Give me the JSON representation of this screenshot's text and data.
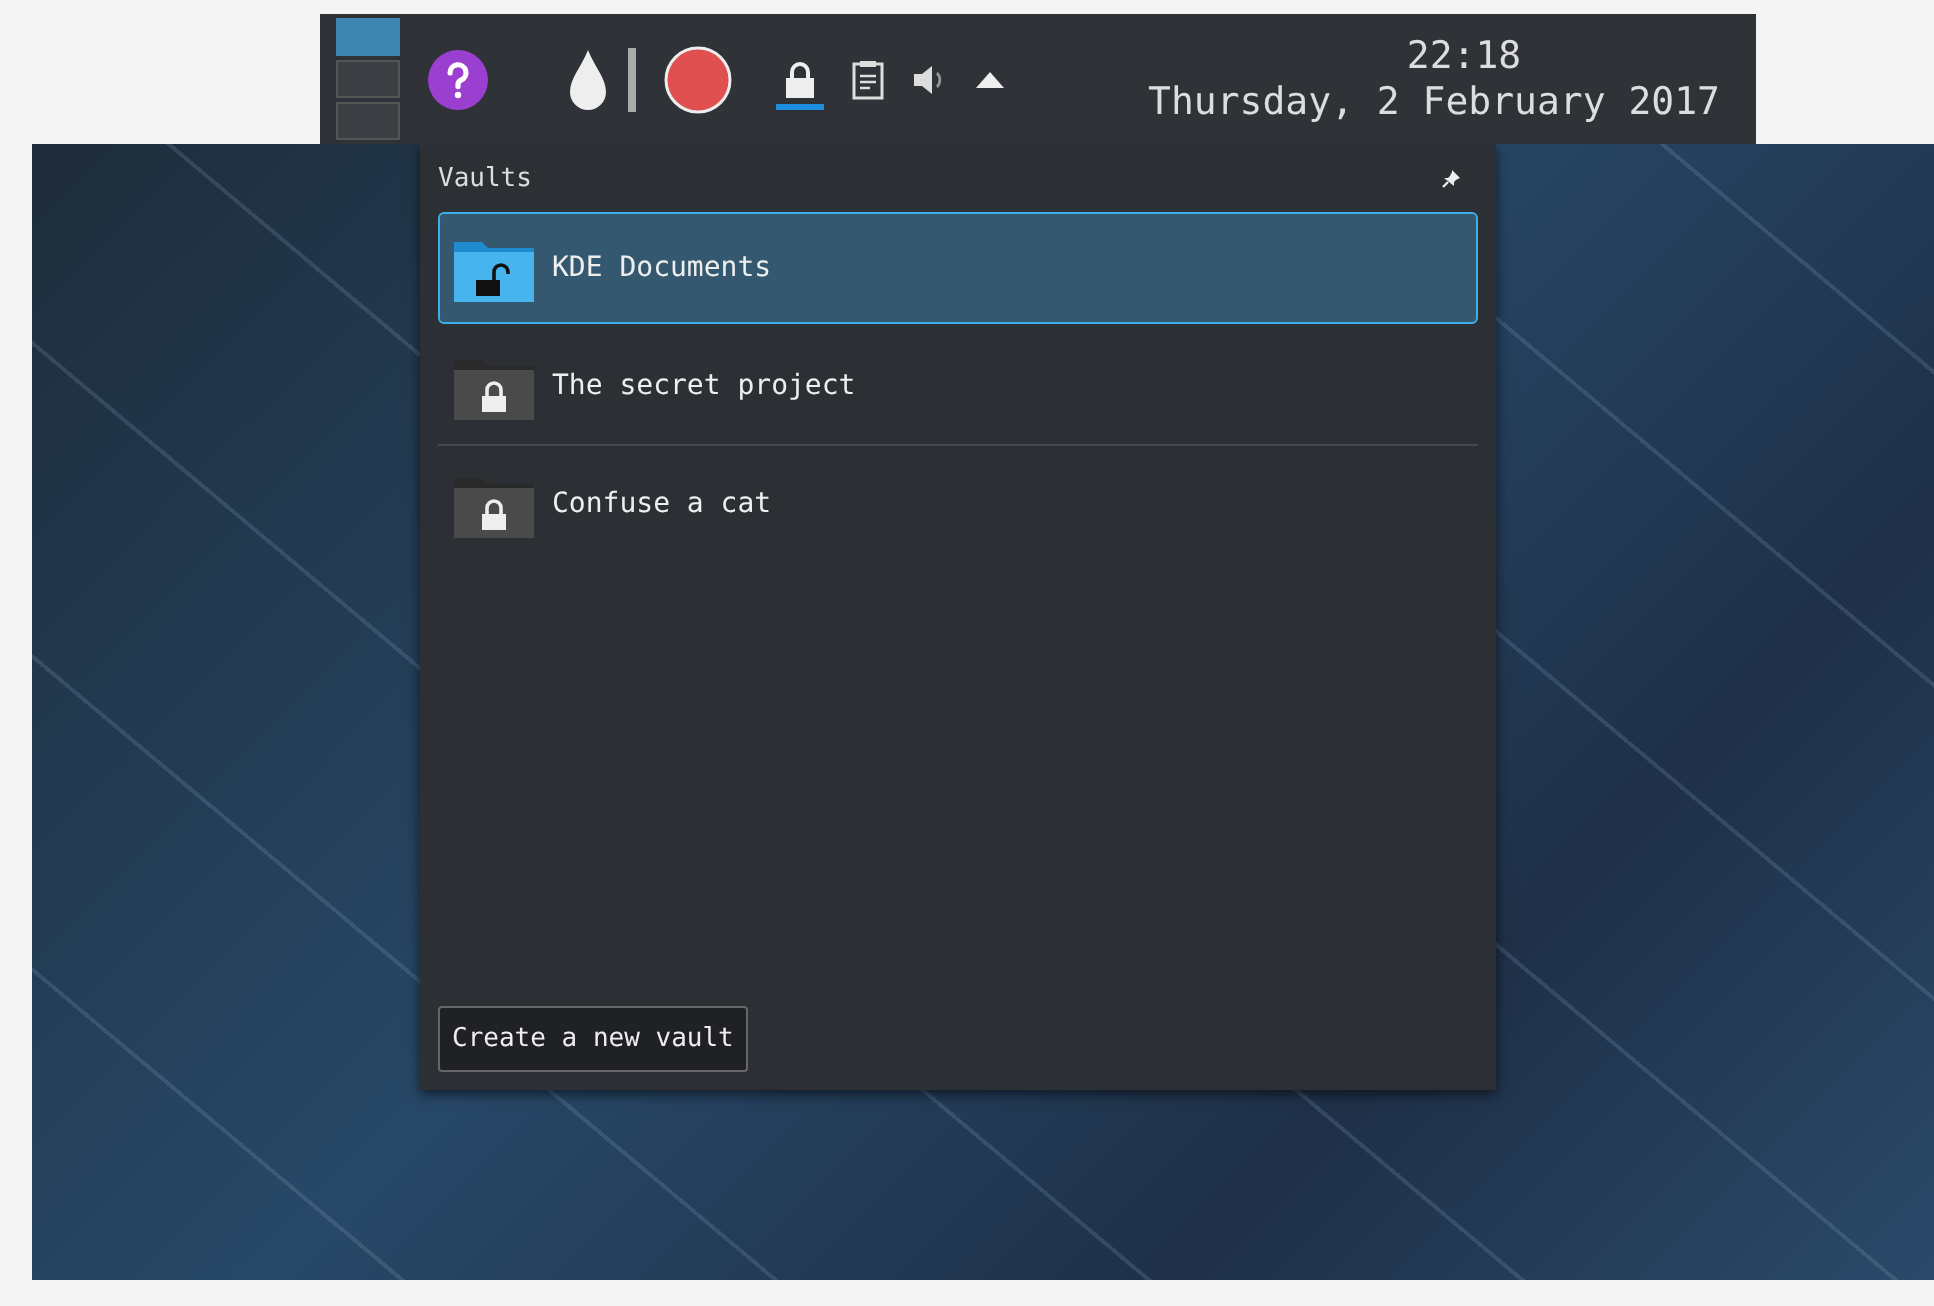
{
  "panel": {
    "pager": [
      {
        "selected": true
      },
      {
        "selected": false
      },
      {
        "selected": false
      }
    ],
    "clock": {
      "time": "22:18",
      "date": "Thursday, 2 February 2017"
    }
  },
  "popup": {
    "title": "Vaults",
    "vaults": [
      {
        "name": "KDE Documents",
        "selected": true,
        "locked": false
      },
      {
        "name": "The secret project",
        "selected": false,
        "locked": true
      },
      {
        "name": "Confuse a cat",
        "selected": false,
        "locked": true
      }
    ],
    "button": "Create a new vault"
  }
}
